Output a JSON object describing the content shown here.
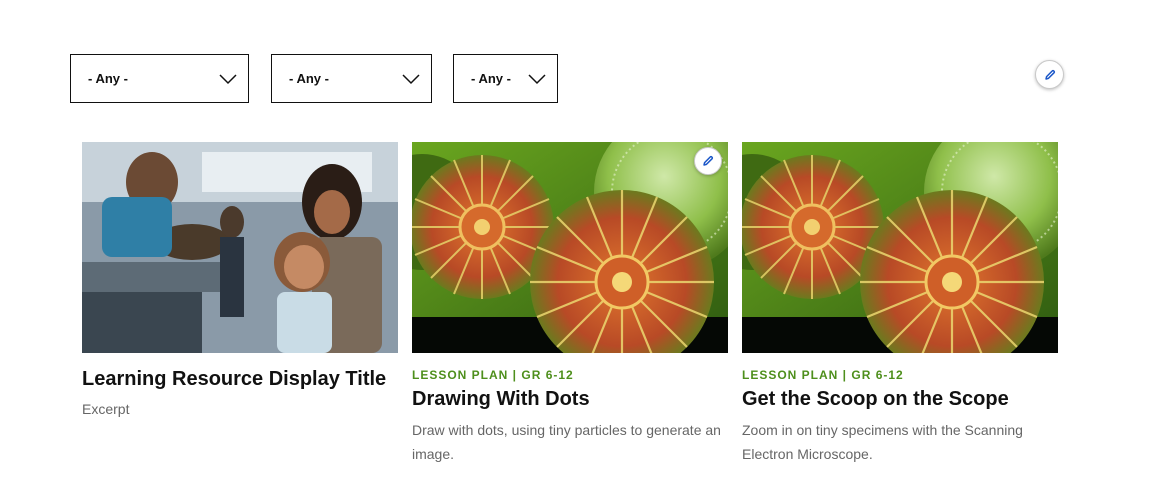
{
  "filters": [
    {
      "selected": "- Any -"
    },
    {
      "selected": "- Any -"
    },
    {
      "selected": "- Any -"
    }
  ],
  "colors": {
    "accent_green": "#4e8f1c",
    "edit_blue": "#1a56c8",
    "text_dark": "#111111",
    "text_muted": "#666666"
  },
  "icons": {
    "filter_chevron": "chevron-down-icon",
    "edit": "pencil-icon"
  },
  "cards": [
    {
      "image": "museum-visitors-photo",
      "title": "Learning Resource Display Title",
      "excerpt": "Excerpt"
    },
    {
      "image": "diatom-micrograph",
      "eyebrow": "LESSON PLAN | GR 6-12",
      "title": "Drawing With Dots",
      "excerpt": "Draw with dots, using tiny particles to generate an image."
    },
    {
      "image": "diatom-micrograph",
      "eyebrow": "LESSON PLAN | GR 6-12",
      "title": "Get the Scoop on the Scope",
      "excerpt": "Zoom in on tiny specimens with the Scanning Electron Microscope."
    }
  ]
}
